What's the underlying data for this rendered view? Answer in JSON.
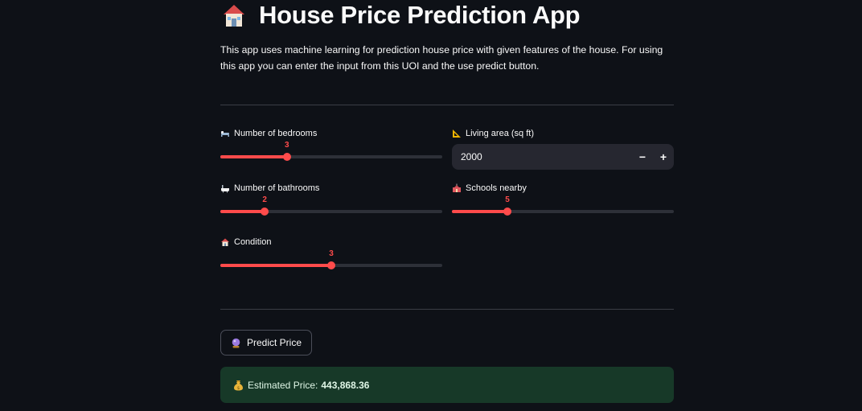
{
  "app": {
    "title": "House Price Prediction App",
    "title_icon": "house-icon",
    "description": "This app uses machine learning for prediction house price with given features of the house. For using this app you can enter the input from this UOI and the use predict button."
  },
  "inputs": {
    "bedrooms": {
      "icon": "bed-icon",
      "label": "Number of bedrooms",
      "value": "3",
      "fill_fraction": 0.3
    },
    "living_area": {
      "icon": "triangle-ruler-icon",
      "label": "Living area (sq ft)",
      "value": "2000",
      "minus_label": "−",
      "plus_label": "+"
    },
    "bathrooms": {
      "icon": "bathtub-icon",
      "label": "Number of bathrooms",
      "value": "2",
      "fill_fraction": 0.2
    },
    "schools": {
      "icon": "school-icon",
      "label": "Schools nearby",
      "value": "5",
      "fill_fraction": 0.25
    },
    "condition": {
      "icon": "house-icon",
      "label": "Condition",
      "value": "3",
      "fill_fraction": 0.5
    }
  },
  "actions": {
    "predict_icon": "crystal-ball-icon",
    "predict_label": "Predict Price"
  },
  "result": {
    "icon": "money-bag-icon",
    "label": "Estimated Price:",
    "value": "443,868.36"
  },
  "colors": {
    "background": "#0e1117",
    "accent": "#ff4b4b",
    "input_background": "#262730",
    "success_background": "#173928"
  }
}
